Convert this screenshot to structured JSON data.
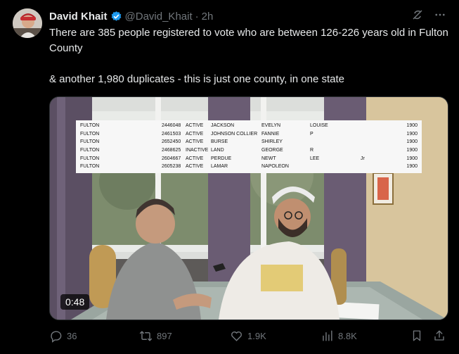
{
  "author": {
    "name": "David Khait",
    "handle": "@David_Khait",
    "separator": "·",
    "time": "2h"
  },
  "tweet": {
    "line1": "There are 385 people registered to vote who are between 126-226 years old in Fulton County",
    "line2": "& another 1,980 duplicates - this is just one county, in one state"
  },
  "media": {
    "duration": "0:48",
    "registry_rows": [
      {
        "county": "FULTON",
        "id": "2446048",
        "status": "ACTIVE",
        "last": "JACKSON",
        "first": "EVELYN",
        "middle": "LOUISE",
        "suffix": "",
        "year": "1900"
      },
      {
        "county": "FULTON",
        "id": "2461503",
        "status": "ACTIVE",
        "last": "JOHNSON COLLIER",
        "first": "FANNIE",
        "middle": "P",
        "suffix": "",
        "year": "1900"
      },
      {
        "county": "FULTON",
        "id": "2652450",
        "status": "ACTIVE",
        "last": "BURSE",
        "first": "SHIRLEY",
        "middle": "",
        "suffix": "",
        "year": "1900"
      },
      {
        "county": "FULTON",
        "id": "2468625",
        "status": "INACTIVE",
        "last": "LAND",
        "first": "GEORGE",
        "middle": "R",
        "suffix": "",
        "year": "1900"
      },
      {
        "county": "FULTON",
        "id": "2604667",
        "status": "ACTIVE",
        "last": "PERDUE",
        "first": "NEWT",
        "middle": "LEE",
        "suffix": "Jr",
        "year": "1900"
      },
      {
        "county": "FULTON",
        "id": "2605238",
        "status": "ACTIVE",
        "last": "LAMAR",
        "first": "NAPOLEON",
        "middle": "",
        "suffix": "",
        "year": "1900"
      }
    ]
  },
  "actions": {
    "replies": "36",
    "reposts": "897",
    "likes": "1.9K",
    "views": "8.8K"
  },
  "colors": {
    "background": "#000000",
    "text": "#e7e9ea",
    "muted": "#71767b",
    "verified": "#1d9bf0"
  },
  "icons": {
    "verified": "verified-badge-icon",
    "grok": "grok-icon",
    "more": "more-icon",
    "reply": "reply-icon",
    "repost": "repost-icon",
    "like": "like-icon",
    "views": "views-icon",
    "bookmark": "bookmark-icon",
    "share": "share-icon"
  }
}
